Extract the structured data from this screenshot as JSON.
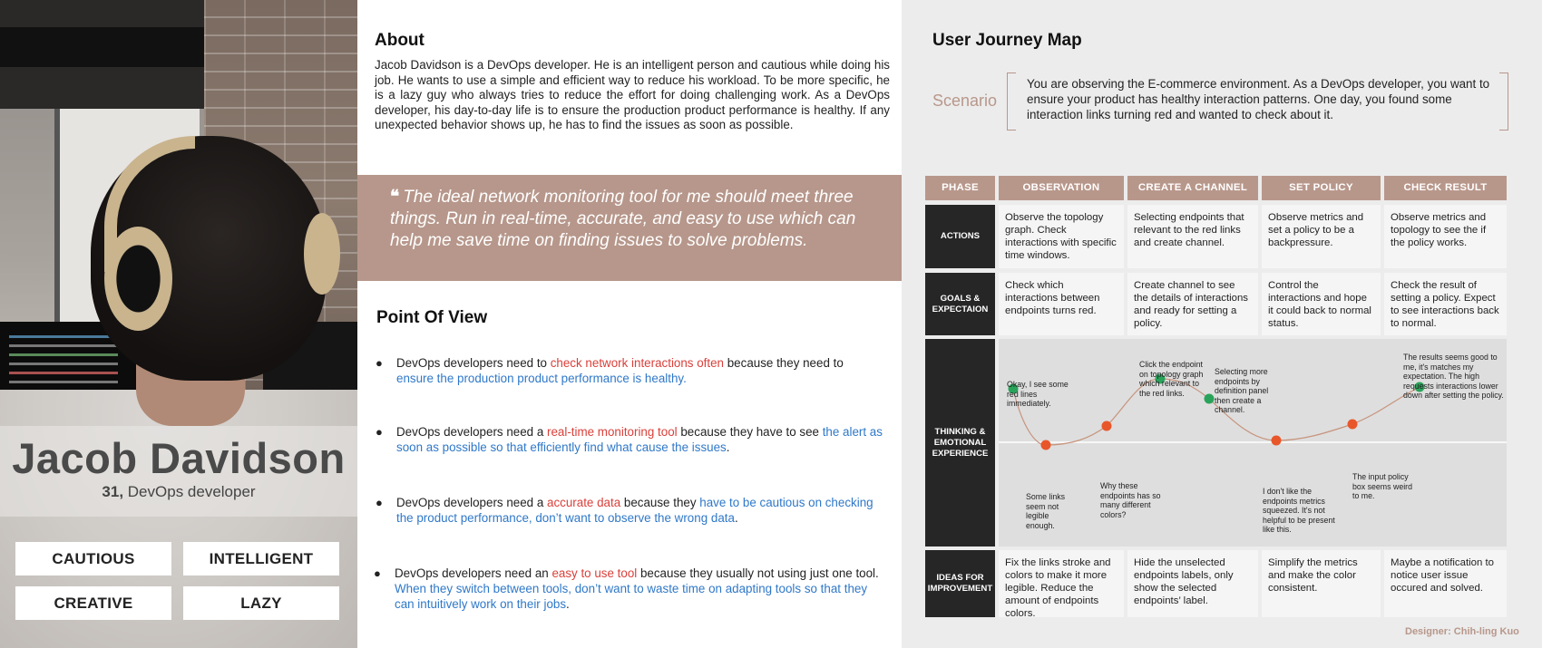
{
  "persona": {
    "name": "Jacob Davidson",
    "age": "31,",
    "role": "DevOps developer",
    "traits": [
      "CAUTIOUS",
      "INTELLIGENT",
      "CREATIVE",
      "LAZY"
    ]
  },
  "about": {
    "title": "About",
    "body": "Jacob Davidson is a DevOps developer. He is an intelligent person and cautious while doing his job. He wants to use a simple and efficient way to reduce his workload. To be more specific, he is a lazy guy who always tries to reduce the effort for doing challenging work. As a DevOps developer, his day-to-day life is to ensure the production product performance is healthy. If any unexpected behavior shows up, he has to find the issues as soon as possible."
  },
  "quote": {
    "mark": "❝",
    "text": "The ideal network monitoring tool for me should meet three things. Run in real-time, accurate, and easy to use which can help me save time on finding issues to solve problems."
  },
  "pov": {
    "title": "Point Of View",
    "bullet": "●",
    "items": [
      {
        "a": "DevOps developers need to ",
        "b": "check network interactions often",
        "c": " because they need to ",
        "d": "ensure the production product performance is healthy.",
        "e": ""
      },
      {
        "a": "DevOps developers need a ",
        "b": "real-time monitoring tool",
        "c": " because they have to see ",
        "d": "the alert as soon as possible so that efficiently find what cause the issues",
        "e": "."
      },
      {
        "a": "DevOps developers need a ",
        "b": "accurate data",
        "c": " because they ",
        "d": "have to be cautious on checking the product performance, don’t want to observe the wrong data",
        "e": "."
      },
      {
        "a": "DevOps developers need an ",
        "b": "easy to use tool",
        "c": " because they usually not using just one tool. ",
        "d": "When they switch between tools, don’t want to waste time on adapting tools so that they can intuitively work on their jobs",
        "e": "."
      }
    ]
  },
  "journey": {
    "title": "User Journey Map",
    "scenario_label": "Scenario",
    "scenario_text": "You are observing the E-commerce environment. As a DevOps developer, you want to ensure your product has healthy interaction patterns. One day, you found some interaction links turning red and wanted to check about it.",
    "phase_label": "PHASE",
    "phases": [
      "OBSERVATION",
      "CREATE A CHANNEL",
      "SET POLICY",
      "CHECK RESULT"
    ],
    "row_labels": {
      "actions": "ACTIONS",
      "goals": "GOALS & EXPECTAION",
      "thinking": "THINKING & EMOTIONAL EXPERIENCE",
      "ideas": "IDEAS FOR IMPROVEMENT"
    },
    "actions": [
      "Observe the topology graph. Check interactions with specific time windows.",
      "Selecting endpoints that relevant to the red links and create channel.",
      "Observe metrics and set a policy to be a backpressure.",
      "Observe metrics and topology to see the if the policy works."
    ],
    "goals": [
      "Check which interactions between endpoints turns red.",
      "Create channel to see the details of interactions and ready for setting a policy.",
      "Control the interactions and hope it could back to normal status.",
      "Check the result of setting a policy. Expect to see interactions back to normal."
    ],
    "ideas": [
      "Fix the links stroke and colors to make it more legible. Reduce the amount of endpoints colors.",
      "Hide the unselected endpoints labels, only show the selected endpoints’ label.",
      "Simplify the metrics and make the color consistent.",
      "Maybe a notification to notice user issue occured and solved."
    ],
    "emotions": [
      {
        "text": "Okay, I see some red lines immediately.",
        "mood": "positive"
      },
      {
        "text": "Some links seem not legible enough.",
        "mood": "negative"
      },
      {
        "text": "Why these endpoints has so many different colors?",
        "mood": "negative"
      },
      {
        "text": "Click the endpoint on topology graph which relevant to the red links.",
        "mood": "positive"
      },
      {
        "text": "Selecting more endpoints by definition panel then create a channel.",
        "mood": "positive"
      },
      {
        "text": "I don't like the endpoints metrics squeezed. It's not helpful to be present like this.",
        "mood": "negative"
      },
      {
        "text": "The input policy box seems weird to me.",
        "mood": "negative"
      },
      {
        "text": "The results seems good to me, it's matches my expectation. The high requests interactions lower down after setting the policy.",
        "mood": "positive"
      }
    ],
    "colors": {
      "positive": "#2aa35a",
      "negative": "#e8572a",
      "curve": "#c7937c",
      "accent": "#b8978b"
    },
    "designer": "Designer: Chih-ling Kuo"
  }
}
